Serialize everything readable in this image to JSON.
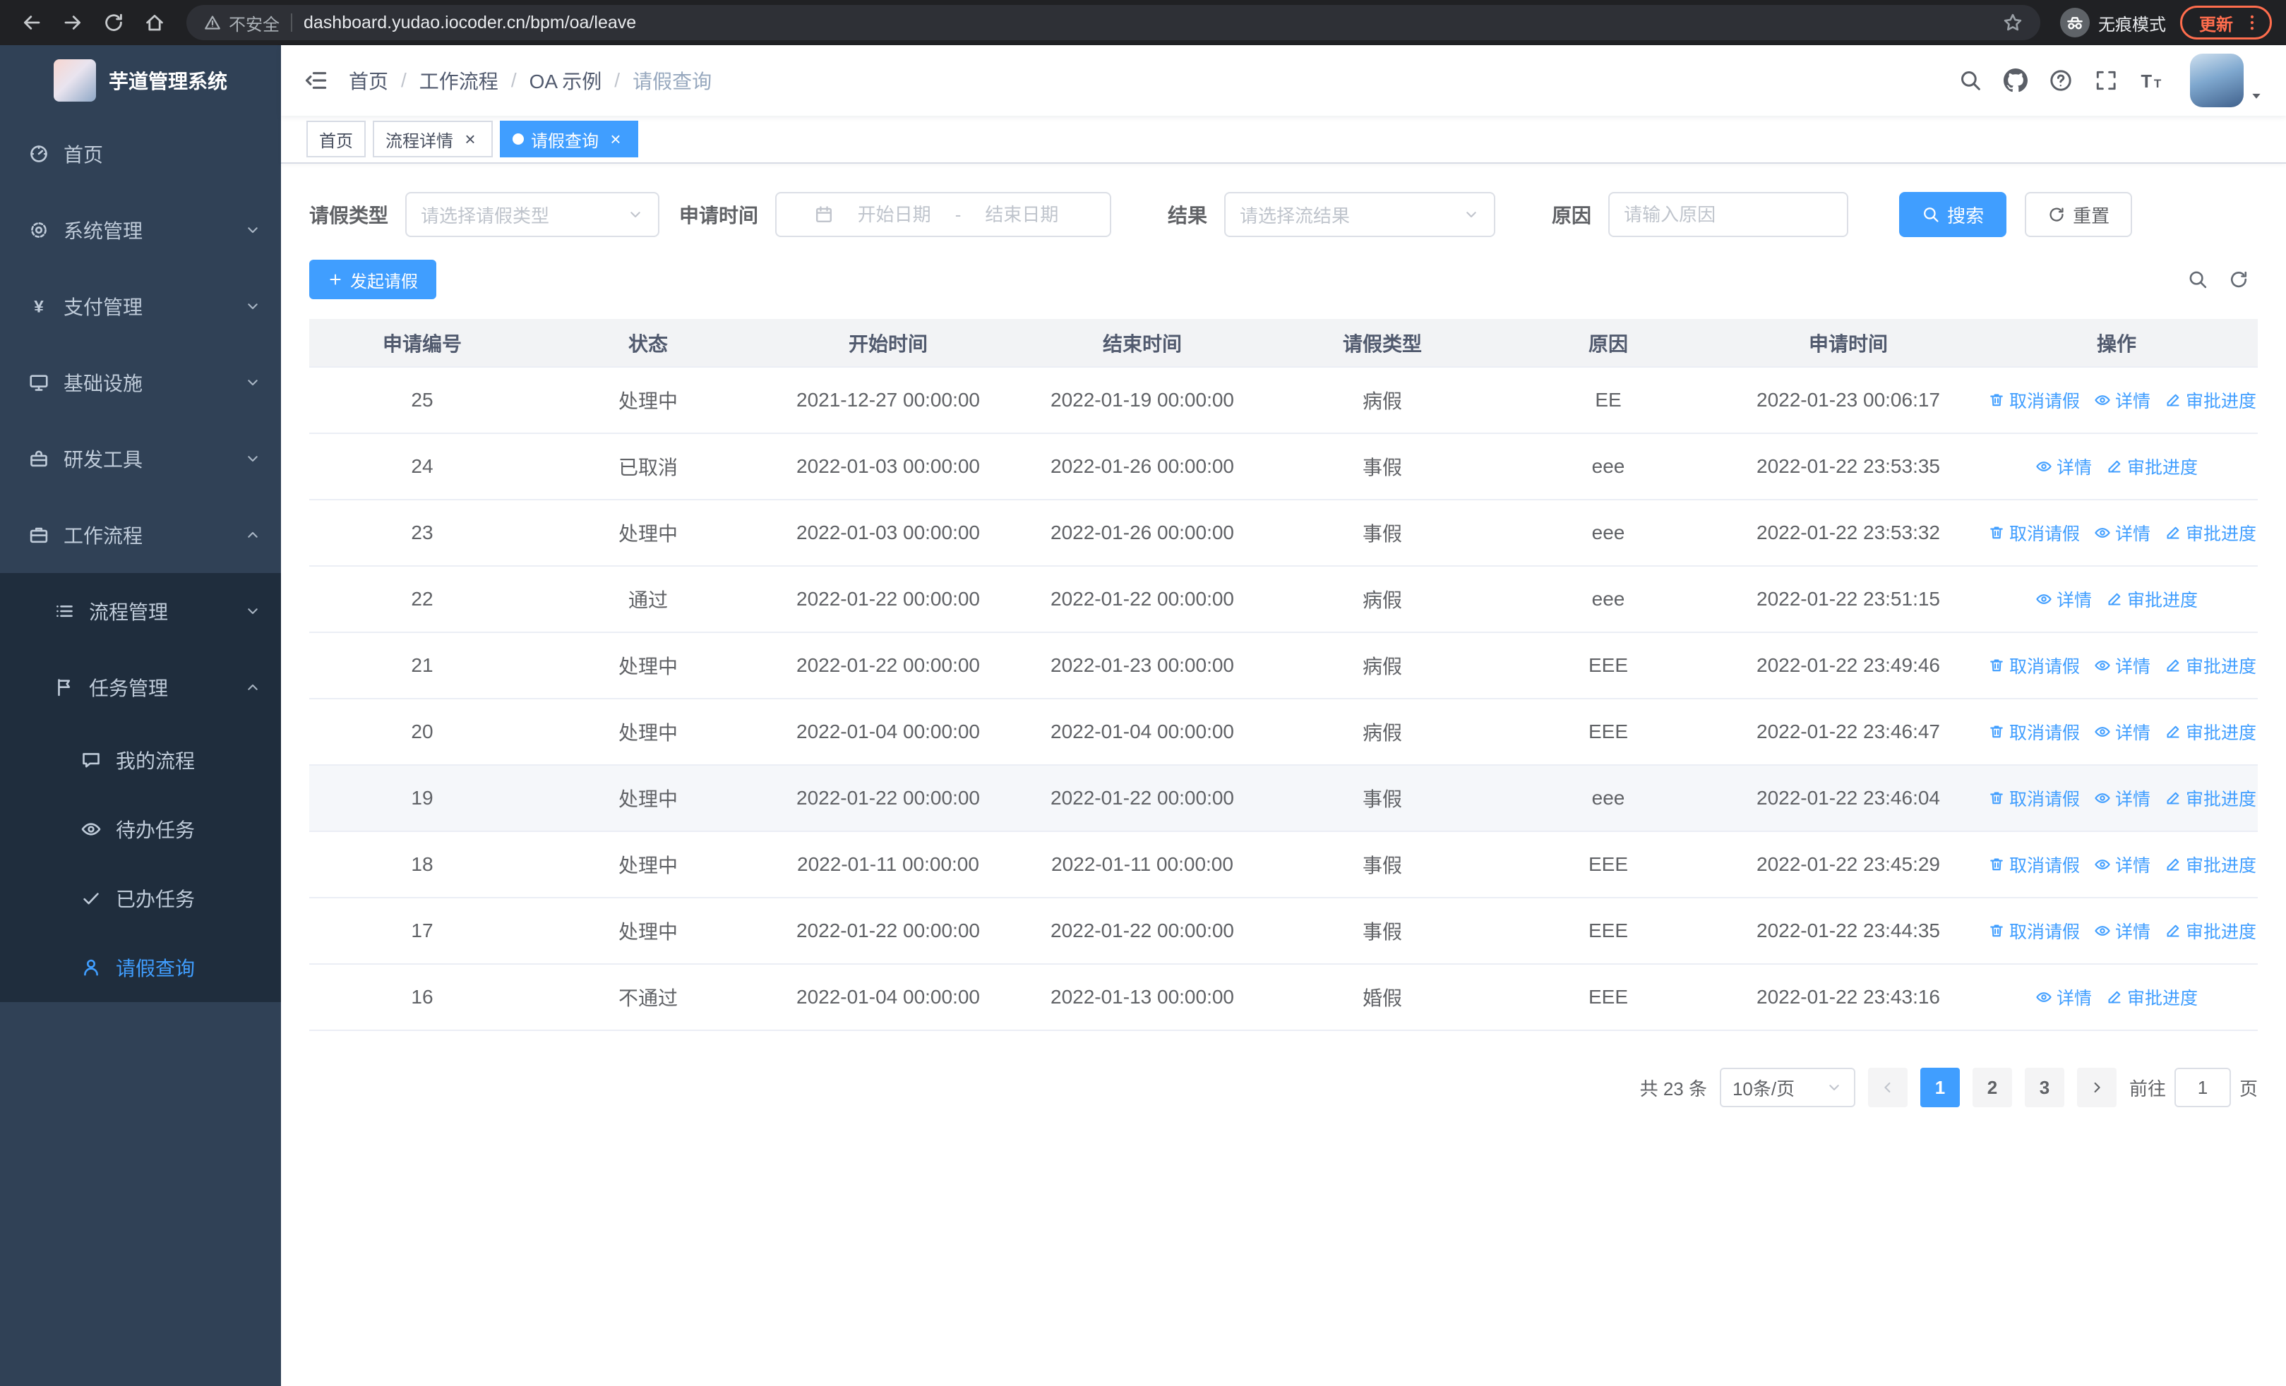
{
  "colors": {
    "primary": "#409eff",
    "sidebar_bg": "#304156",
    "submenu_bg": "#1f2d3d",
    "update_accent": "#ff6d4d"
  },
  "browser": {
    "nav_icons": [
      "back-icon",
      "forward-icon",
      "reload-icon",
      "home-icon"
    ],
    "security_warning": "不安全",
    "url": "dashboard.yudao.iocoder.cn/bpm/oa/leave",
    "incognito_label": "无痕模式",
    "update_label": "更新"
  },
  "sidebar": {
    "logo_title": "芋道管理系统",
    "items": [
      {
        "key": "home",
        "label": "首页",
        "icon": "dashboard-icon",
        "level": 1,
        "chevron": null,
        "active": false,
        "submenu": false
      },
      {
        "key": "system-management",
        "label": "系统管理",
        "icon": "gear-icon",
        "level": 1,
        "chevron": "down",
        "active": false,
        "submenu": false
      },
      {
        "key": "payment-management",
        "label": "支付管理",
        "icon": "yen-icon",
        "level": 1,
        "chevron": "down",
        "active": false,
        "submenu": false
      },
      {
        "key": "infrastructure",
        "label": "基础设施",
        "icon": "monitor-icon",
        "level": 1,
        "chevron": "down",
        "active": false,
        "submenu": false
      },
      {
        "key": "dev-tools",
        "label": "研发工具",
        "icon": "toolbox-icon",
        "level": 1,
        "chevron": "down",
        "active": false,
        "submenu": false
      },
      {
        "key": "workflow",
        "label": "工作流程",
        "icon": "briefcase-icon",
        "level": 1,
        "chevron": "up",
        "active": false,
        "submenu": false
      },
      {
        "key": "process-management",
        "label": "流程管理",
        "icon": "list-icon",
        "level": 2,
        "chevron": "down",
        "active": false,
        "submenu": true
      },
      {
        "key": "task-management",
        "label": "任务管理",
        "icon": "flag-icon",
        "level": 2,
        "chevron": "up",
        "active": false,
        "submenu": true
      },
      {
        "key": "my-process",
        "label": "我的流程",
        "icon": "chat-icon",
        "level": 3,
        "chevron": null,
        "active": false,
        "submenu": true
      },
      {
        "key": "todo-task",
        "label": "待办任务",
        "icon": "eye-icon",
        "level": 3,
        "chevron": null,
        "active": false,
        "submenu": true
      },
      {
        "key": "done-task",
        "label": "已办任务",
        "icon": "check-icon",
        "level": 3,
        "chevron": null,
        "active": false,
        "submenu": true
      },
      {
        "key": "leave-query",
        "label": "请假查询",
        "icon": "user-icon",
        "level": 3,
        "chevron": null,
        "active": true,
        "submenu": true
      }
    ]
  },
  "header": {
    "breadcrumb": [
      "首页",
      "工作流程",
      "OA 示例",
      "请假查询"
    ],
    "icons": [
      "search-icon",
      "github-icon",
      "question-icon",
      "fullscreen-icon",
      "font-size-icon"
    ]
  },
  "tabs": [
    {
      "key": "home",
      "label": "首页",
      "closable": false,
      "active": false
    },
    {
      "key": "process-detail",
      "label": "流程详情",
      "closable": true,
      "active": false
    },
    {
      "key": "leave-query",
      "label": "请假查询",
      "closable": true,
      "active": true
    }
  ],
  "filters": {
    "leave_type_label": "请假类型",
    "leave_type_placeholder": "请选择请假类型",
    "apply_time_label": "申请时间",
    "start_date_placeholder": "开始日期",
    "range_separator": "-",
    "end_date_placeholder": "结束日期",
    "result_label": "结果",
    "result_placeholder": "请选择流结果",
    "reason_label": "原因",
    "reason_placeholder": "请输入原因",
    "search_button": "搜索",
    "reset_button": "重置"
  },
  "toolbar": {
    "create_button": "发起请假",
    "icons": [
      "search-icon",
      "refresh-icon"
    ]
  },
  "table": {
    "columns": [
      {
        "key": "id",
        "label": "申请编号"
      },
      {
        "key": "status",
        "label": "状态"
      },
      {
        "key": "start_time",
        "label": "开始时间"
      },
      {
        "key": "end_time",
        "label": "结束时间"
      },
      {
        "key": "leave_type",
        "label": "请假类型"
      },
      {
        "key": "reason",
        "label": "原因"
      },
      {
        "key": "apply_time",
        "label": "申请时间"
      },
      {
        "key": "ops",
        "label": "操作"
      }
    ],
    "action_defs": [
      {
        "key": "cancel",
        "label": "取消请假",
        "icon": "trash-icon"
      },
      {
        "key": "detail",
        "label": "详情",
        "icon": "eye-icon"
      },
      {
        "key": "progress",
        "label": "审批进度",
        "icon": "edit-icon"
      }
    ],
    "rows": [
      {
        "id": "25",
        "status": "处理中",
        "start_time": "2021-12-27 00:00:00",
        "end_time": "2022-01-19 00:00:00",
        "leave_type": "病假",
        "reason": "EE",
        "apply_time": "2022-01-23 00:06:17",
        "actions": [
          "cancel",
          "detail",
          "progress"
        ],
        "highlighted": false
      },
      {
        "id": "24",
        "status": "已取消",
        "start_time": "2022-01-03 00:00:00",
        "end_time": "2022-01-26 00:00:00",
        "leave_type": "事假",
        "reason": "eee",
        "apply_time": "2022-01-22 23:53:35",
        "actions": [
          "detail",
          "progress"
        ],
        "highlighted": false
      },
      {
        "id": "23",
        "status": "处理中",
        "start_time": "2022-01-03 00:00:00",
        "end_time": "2022-01-26 00:00:00",
        "leave_type": "事假",
        "reason": "eee",
        "apply_time": "2022-01-22 23:53:32",
        "actions": [
          "cancel",
          "detail",
          "progress"
        ],
        "highlighted": false
      },
      {
        "id": "22",
        "status": "通过",
        "start_time": "2022-01-22 00:00:00",
        "end_time": "2022-01-22 00:00:00",
        "leave_type": "病假",
        "reason": "eee",
        "apply_time": "2022-01-22 23:51:15",
        "actions": [
          "detail",
          "progress"
        ],
        "highlighted": false
      },
      {
        "id": "21",
        "status": "处理中",
        "start_time": "2022-01-22 00:00:00",
        "end_time": "2022-01-23 00:00:00",
        "leave_type": "病假",
        "reason": "EEE",
        "apply_time": "2022-01-22 23:49:46",
        "actions": [
          "cancel",
          "detail",
          "progress"
        ],
        "highlighted": false
      },
      {
        "id": "20",
        "status": "处理中",
        "start_time": "2022-01-04 00:00:00",
        "end_time": "2022-01-04 00:00:00",
        "leave_type": "病假",
        "reason": "EEE",
        "apply_time": "2022-01-22 23:46:47",
        "actions": [
          "cancel",
          "detail",
          "progress"
        ],
        "highlighted": false
      },
      {
        "id": "19",
        "status": "处理中",
        "start_time": "2022-01-22 00:00:00",
        "end_time": "2022-01-22 00:00:00",
        "leave_type": "事假",
        "reason": "eee",
        "apply_time": "2022-01-22 23:46:04",
        "actions": [
          "cancel",
          "detail",
          "progress"
        ],
        "highlighted": true
      },
      {
        "id": "18",
        "status": "处理中",
        "start_time": "2022-01-11 00:00:00",
        "end_time": "2022-01-11 00:00:00",
        "leave_type": "事假",
        "reason": "EEE",
        "apply_time": "2022-01-22 23:45:29",
        "actions": [
          "cancel",
          "detail",
          "progress"
        ],
        "highlighted": false
      },
      {
        "id": "17",
        "status": "处理中",
        "start_time": "2022-01-22 00:00:00",
        "end_time": "2022-01-22 00:00:00",
        "leave_type": "事假",
        "reason": "EEE",
        "apply_time": "2022-01-22 23:44:35",
        "actions": [
          "cancel",
          "detail",
          "progress"
        ],
        "highlighted": false
      },
      {
        "id": "16",
        "status": "不通过",
        "start_time": "2022-01-04 00:00:00",
        "end_time": "2022-01-13 00:00:00",
        "leave_type": "婚假",
        "reason": "EEE",
        "apply_time": "2022-01-22 23:43:16",
        "actions": [
          "detail",
          "progress"
        ],
        "highlighted": false
      }
    ]
  },
  "pagination": {
    "total": "共 23 条",
    "page_size": "10条/页",
    "pages": [
      "1",
      "2",
      "3"
    ],
    "active_page": "1",
    "goto_label": "前往",
    "goto_value": "1",
    "goto_suffix": "页"
  }
}
